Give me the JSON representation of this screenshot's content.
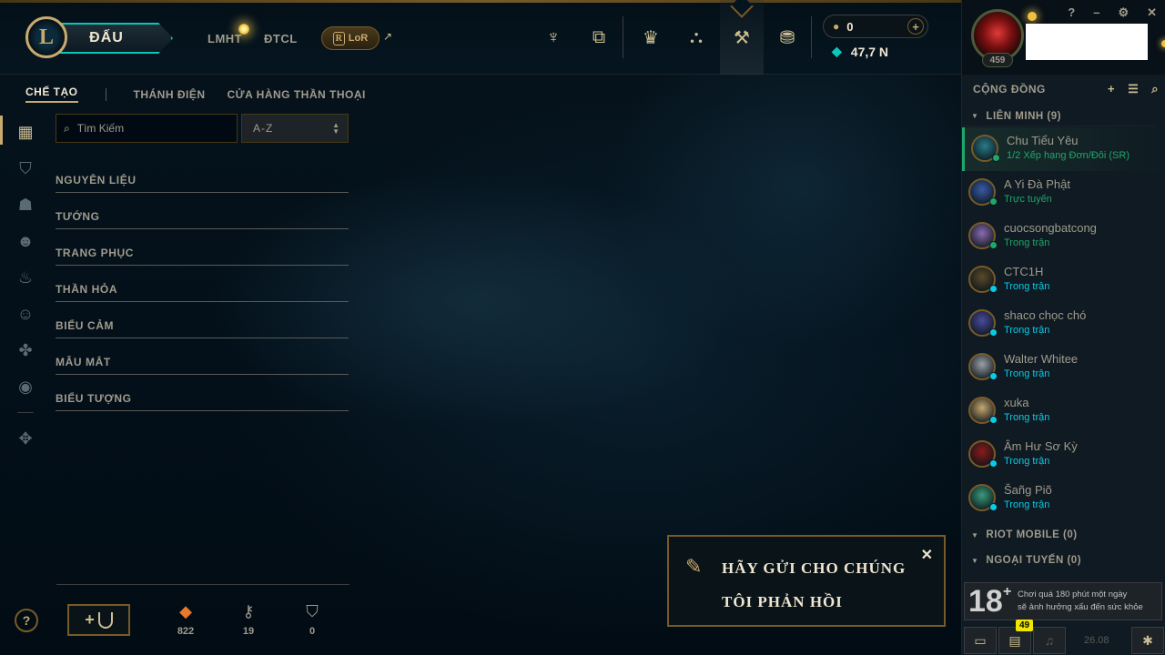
{
  "topbar": {
    "logo_letter": "L",
    "play_label": "ĐẤU",
    "nav_lol": "LMHT",
    "nav_tft": "ĐTCL",
    "lor_label": "LoR",
    "lor_mark": "R",
    "ext_arrow": "↗",
    "tools": [
      {
        "name": "home-icon",
        "glyph": "♆"
      },
      {
        "name": "tft-icon",
        "glyph": "⧉"
      },
      {
        "name": "rank-icon",
        "glyph": "♛"
      },
      {
        "name": "inventory-icon",
        "glyph": "⛬"
      },
      {
        "name": "crafting-icon",
        "glyph": "⚒"
      },
      {
        "name": "store-icon",
        "glyph": "⛃"
      }
    ],
    "rp_value": "0",
    "rp_plus": "+",
    "be_value": "47,7 N"
  },
  "profile": {
    "level": "459",
    "controls": [
      "?",
      "–",
      "⚙",
      "✕"
    ]
  },
  "social": {
    "title": "CỘNG ĐỒNG",
    "icon_add": "+",
    "icon_list": "☰",
    "icon_search": "⌕",
    "groups": [
      {
        "label": "LIÊN MINH (9)"
      },
      {
        "label": "RIOT MOBILE (0)"
      },
      {
        "label": "NGOẠI TUYẾN (0)"
      }
    ],
    "friends": [
      {
        "name": "Chu Tiểu Yêu",
        "status": "1/2 Xếp hạng Đơn/Đôi (SR)",
        "status_color": "#1fa66a",
        "dot": "#1fa66a",
        "ava": "#2a7a8a"
      },
      {
        "name": "A Yi Đà Phật",
        "status": "Trực tuyến",
        "status_color": "#1fa66a",
        "dot": "#1fa66a",
        "ava": "#3a5aa8"
      },
      {
        "name": "cuocsongbatcong",
        "status": "Trong trận",
        "status_color": "#1fa66a",
        "dot": "#1fa66a",
        "ava": "#8a6ab0"
      },
      {
        "name": "CTC1H",
        "status": "Trong trận",
        "status_color": "#0acbe6",
        "dot": "#0acbe6",
        "ava": "#5a4a2a"
      },
      {
        "name": "shaco chọc chó",
        "status": "Trong trận",
        "status_color": "#0acbe6",
        "dot": "#0acbe6",
        "ava": "#4a4a9a"
      },
      {
        "name": "Walter Whitee",
        "status": "Trong trận",
        "status_color": "#0acbe6",
        "dot": "#0acbe6",
        "ava": "#9aa0a8"
      },
      {
        "name": "xuka",
        "status": "Trong trận",
        "status_color": "#0acbe6",
        "dot": "#0acbe6",
        "ava": "#c8a870"
      },
      {
        "name": "Âm Hư Sơ Kỳ",
        "status": "Trong trận",
        "status_color": "#0acbe6",
        "dot": "#0acbe6",
        "ava": "#8a1a1a"
      },
      {
        "name": "Šañg Piõ",
        "status": "Trong trận",
        "status_color": "#0acbe6",
        "dot": "#0acbe6",
        "ava": "#3a9a7a"
      }
    ],
    "age_rating": "18",
    "age_plus": "+",
    "age_warning_line1": "Chơi quá 180 phút một ngày",
    "age_warning_line2": "sẽ ảnh hưởng xấu đến sức khỏe",
    "chat_badge": "49",
    "version": "26.08"
  },
  "collection": {
    "tabs": {
      "active": "CHẾ TẠO",
      "sanctum": "THÁNH ĐIỆN",
      "mythic_shop": "CỬA HÀNG THẦN THOẠI"
    },
    "search_placeholder": "Tìm Kiếm",
    "sort_value": "A-Z",
    "categories": [
      "NGUYÊN LIỆU",
      "TƯỚNG",
      "TRANG PHỤC",
      "THẦN HỎA",
      "BIỂU CẢM",
      "MẪU MẮT",
      "BIỂU TƯỢNG"
    ],
    "help": "?",
    "add_ward_plus": "+",
    "resources": [
      {
        "name": "orange-essence-icon",
        "glyph": "◆",
        "value": "822",
        "color": "#e8782a"
      },
      {
        "name": "key-icon",
        "glyph": "⚷",
        "value": "19",
        "color": "#a09b8c"
      },
      {
        "name": "ward-icon",
        "glyph": "⛉",
        "value": "0",
        "color": "#a09b8c"
      }
    ]
  },
  "feedback": {
    "text_line1": "HÃY GỬI CHO CHÚNG",
    "text_line2": "TÔI PHẢN HỒI",
    "close": "✕",
    "pen": "✎"
  }
}
